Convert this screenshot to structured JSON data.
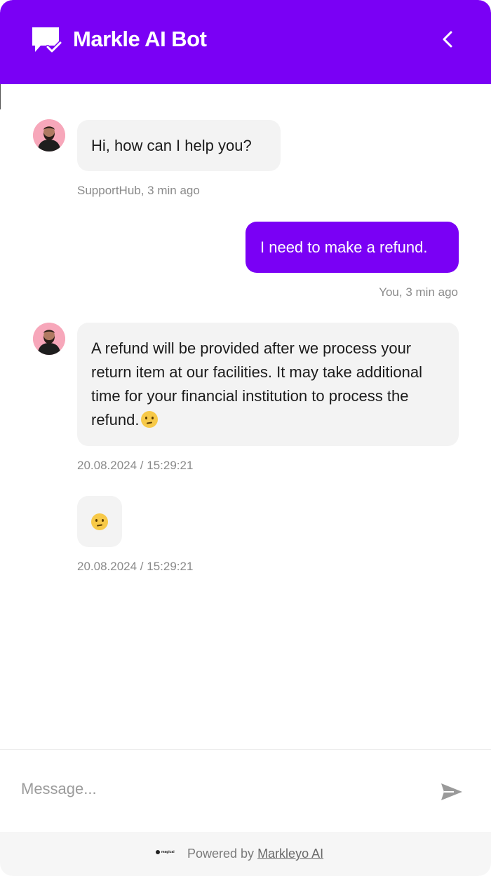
{
  "header": {
    "title": "Markle AI Bot",
    "brand_color": "#7a00f5",
    "logo_icon": "chat-check-icon",
    "back_icon": "chevron-left-icon"
  },
  "messages": [
    {
      "sender": "bot",
      "text": "Hi, how can I help you?",
      "meta": "SupportHub, 3 min ago"
    },
    {
      "sender": "user",
      "text": "I need to make a refund.",
      "meta": "You, 3 min ago"
    },
    {
      "sender": "bot",
      "text": "A refund will be provided after we process your return item at our facilities. It may take additional time for your financial institution to process the refund.",
      "emoji": "thinking-face",
      "meta": "20.08.2024 / 15:29:21"
    },
    {
      "sender": "bot",
      "emoji": "thinking-face",
      "meta": "20.08.2024 / 15:29:21"
    }
  ],
  "composer": {
    "placeholder": "Message...",
    "send_icon": "send-icon"
  },
  "footer": {
    "logo_text": "magicai",
    "powered_by": "Powered by ",
    "link_text": "Markleyo AI"
  }
}
